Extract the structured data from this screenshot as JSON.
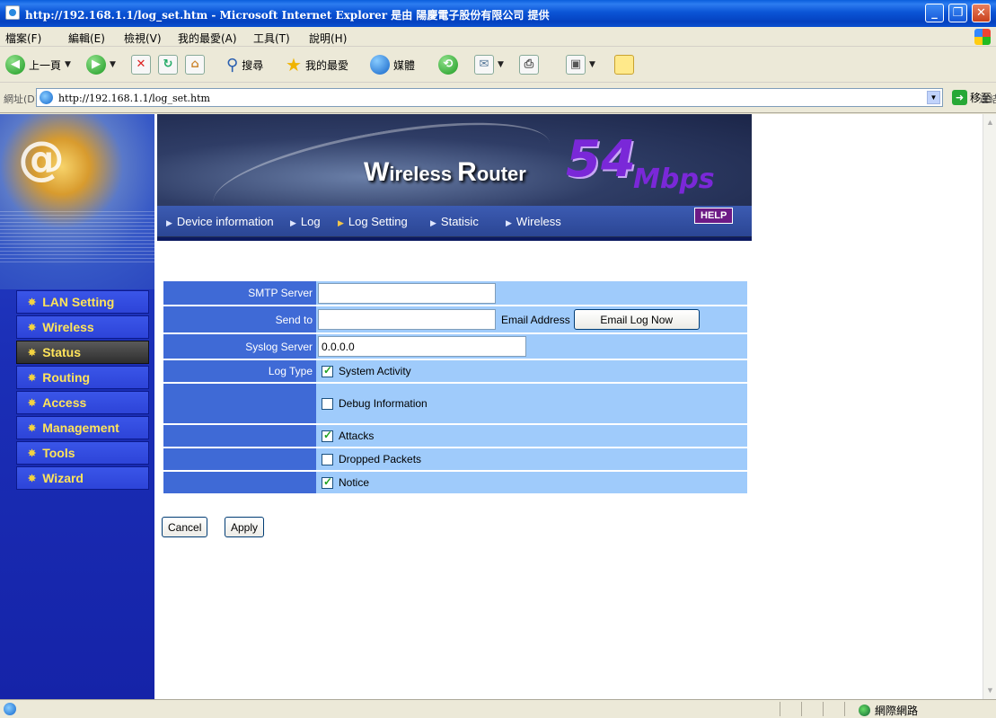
{
  "window": {
    "title": "http://192.168.1.1/log_set.htm - Microsoft Internet Explorer 是由 陽慶電子股份有限公司 提供",
    "min": "_",
    "restore": "❐",
    "close": "✕"
  },
  "menu": [
    "檔案(F)",
    "編輯(E)",
    "檢視(V)",
    "我的最愛(A)",
    "工具(T)",
    "說明(H)"
  ],
  "toolbar": {
    "back": "上一頁",
    "search": "搜尋",
    "favorites": "我的最愛",
    "media": "媒體"
  },
  "address": {
    "label": "網址(D)",
    "url": "http://192.168.1.1/log_set.htm",
    "go": "移至",
    "links": "連結 »"
  },
  "sidebar": {
    "items": [
      {
        "label": "LAN Setting"
      },
      {
        "label": "Wireless"
      },
      {
        "label": "Status"
      },
      {
        "label": "Routing"
      },
      {
        "label": "Access"
      },
      {
        "label": "Management"
      },
      {
        "label": "Tools"
      },
      {
        "label": "Wizard"
      }
    ],
    "active": "Status"
  },
  "banner": {
    "title_w": "W",
    "title_ireless": "ireless ",
    "title_r": "R",
    "title_outer": "outer",
    "speed": "54",
    "unit": "Mbps"
  },
  "topnav": {
    "items": [
      "Device information",
      "Log",
      "Log Setting",
      "Statisic",
      "Wireless"
    ],
    "selected": "Log Setting",
    "help": "HELP"
  },
  "form": {
    "smtp_label": "SMTP Server",
    "smtp_value": "",
    "sendto_label": "Send to",
    "sendto_value": "",
    "email_addr_label": "Email Address",
    "email_now_button": "Email Log Now",
    "syslog_label": "Syslog Server",
    "syslog_value": "0.0.0.0",
    "logtype_label": "Log Type",
    "log_types": [
      {
        "label": "System Activity",
        "checked": true
      },
      {
        "label": "Debug Information",
        "checked": false
      },
      {
        "label": "Attacks",
        "checked": true
      },
      {
        "label": "Dropped Packets",
        "checked": false
      },
      {
        "label": "Notice",
        "checked": true
      }
    ]
  },
  "buttons": {
    "cancel": "Cancel",
    "apply": "Apply"
  },
  "status": {
    "zone": "網際網路"
  }
}
